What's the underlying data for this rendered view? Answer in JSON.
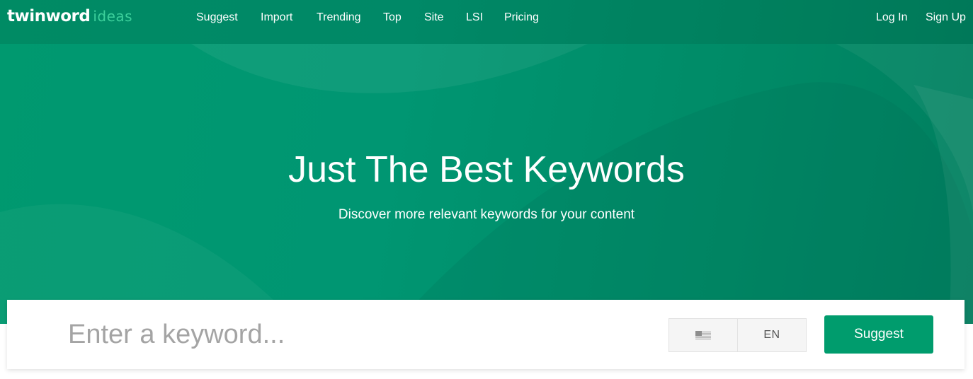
{
  "brand": {
    "logo_main": "twinword",
    "logo_sub": "ideas",
    "accent_color": "#009c6d",
    "logo_sub_color": "#3ccf9b"
  },
  "nav": {
    "items": [
      {
        "label": "Suggest"
      },
      {
        "label": "Import"
      },
      {
        "label": "Trending"
      },
      {
        "label": "Top"
      },
      {
        "label": "Site"
      },
      {
        "label": "LSI"
      },
      {
        "label": "Pricing"
      }
    ],
    "login_label": "Log In",
    "signup_label": "Sign Up"
  },
  "hero": {
    "title": "Just The Best Keywords",
    "subtitle": "Discover more relevant keywords for your content"
  },
  "search": {
    "placeholder": "Enter a keyword...",
    "value": "",
    "country_icon": "us-flag-icon",
    "language": "EN",
    "button_label": "Suggest"
  }
}
